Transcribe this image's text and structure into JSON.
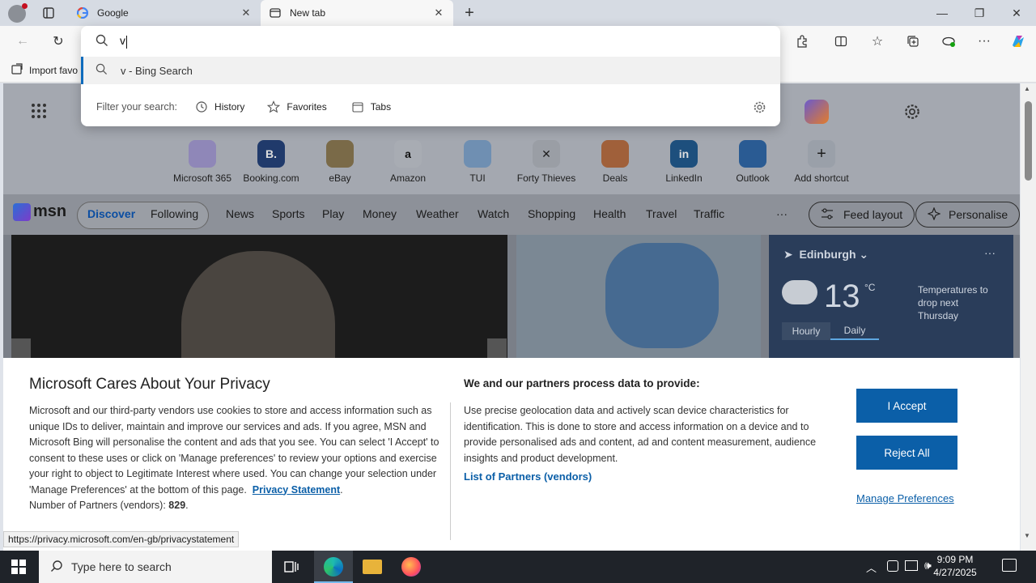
{
  "browser": {
    "tabs": [
      {
        "label": "Google"
      },
      {
        "label": "New tab"
      }
    ],
    "favbar_item": "Import favo",
    "address": {
      "query": "v",
      "suggestion": "v - Bing Search",
      "filter_label": "Filter your search:",
      "filters": [
        "History",
        "Favorites",
        "Tabs"
      ]
    }
  },
  "ntp": {
    "shortcuts": [
      "Microsoft 365",
      "Booking.com",
      "eBay",
      "Amazon",
      "TUI",
      "Forty Thieves",
      "Deals",
      "LinkedIn",
      "Outlook",
      "Add shortcut"
    ],
    "msn_logo": "msn",
    "nav": [
      "Discover",
      "Following",
      "News",
      "Sports",
      "Play",
      "Money",
      "Weather",
      "Watch",
      "Shopping",
      "Health",
      "Travel",
      "Traffic"
    ],
    "more": "···",
    "feed_layout": "Feed layout",
    "personalise": "Personalise",
    "weather": {
      "city": "Edinburgh",
      "temp": "13",
      "unit": "°C",
      "note": "Temperatures to drop next Thursday",
      "tabs": [
        "Hourly",
        "Daily"
      ]
    }
  },
  "privacy": {
    "title": "Microsoft Cares About Your Privacy",
    "body": "Microsoft and our third-party vendors use cookies to store and access information such as unique IDs to deliver, maintain and improve our services and ads. If you agree, MSN and Microsoft Bing will personalise the content and ads that you see. You can select 'I Accept' to consent to these uses or click on 'Manage preferences' to review your options and exercise your right to object to Legitimate Interest where used.  You can change your selection under 'Manage Preferences' at the bottom of this page.",
    "privacy_link": "Privacy Statement",
    "partners_label": "Number of Partners (vendors):",
    "partners_count": "829",
    "heading2": "We and our partners process data to provide:",
    "text2": "Use precise geolocation data and actively scan device characteristics for identification. This is done to store and access information on a device and to provide personalised ads and content, ad and content measurement, audience insights and product development.",
    "list_link": "List of Partners (vendors)",
    "accept": "I Accept",
    "reject": "Reject All",
    "manage": "Manage Preferences"
  },
  "status_url": "https://privacy.microsoft.com/en-gb/privacystatement",
  "taskbar": {
    "search_placeholder": "Type here to search",
    "time": "9:09 PM",
    "date": "4/27/2025"
  }
}
